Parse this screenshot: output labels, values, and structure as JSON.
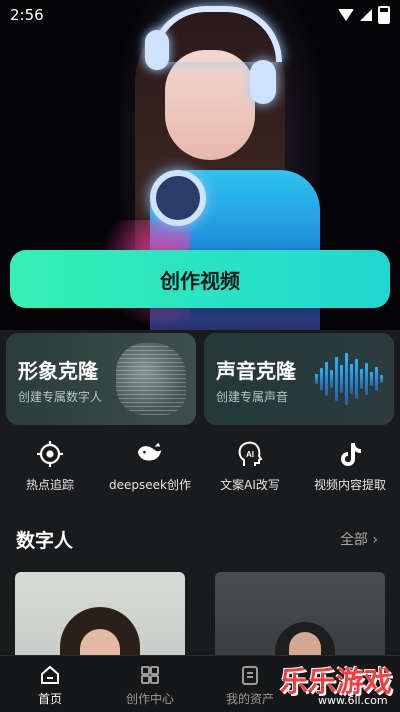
{
  "status_bar": {
    "time": "2:56"
  },
  "hero": {
    "create_button": "创作视频"
  },
  "feature_cards": [
    {
      "title": "形象克隆",
      "subtitle": "创建专属数字人"
    },
    {
      "title": "声音克隆",
      "subtitle": "创建专属声音"
    }
  ],
  "quick_actions": [
    {
      "label": "热点追踪",
      "icon": "target-icon"
    },
    {
      "label": "deepseek创作",
      "icon": "whale-icon"
    },
    {
      "label": "文案AI改写",
      "icon": "ai-head-icon"
    },
    {
      "label": "视频内容提取",
      "icon": "tiktok-icon"
    }
  ],
  "section": {
    "title": "数字人",
    "all_label": "全部"
  },
  "tabs": [
    {
      "label": "首页",
      "icon": "home-icon",
      "active": true
    },
    {
      "label": "创作中心",
      "icon": "grid-icon",
      "active": false
    },
    {
      "label": "我的资产",
      "icon": "document-icon",
      "active": false
    },
    {
      "label": "",
      "icon": "profile-icon",
      "active": false
    }
  ],
  "watermark": {
    "text": "乐乐游戏",
    "sub": "www.6ll.com"
  },
  "colors": {
    "accent_start": "#36f0b3",
    "accent_end": "#1fd7d2",
    "background": "#1a1b1d"
  }
}
